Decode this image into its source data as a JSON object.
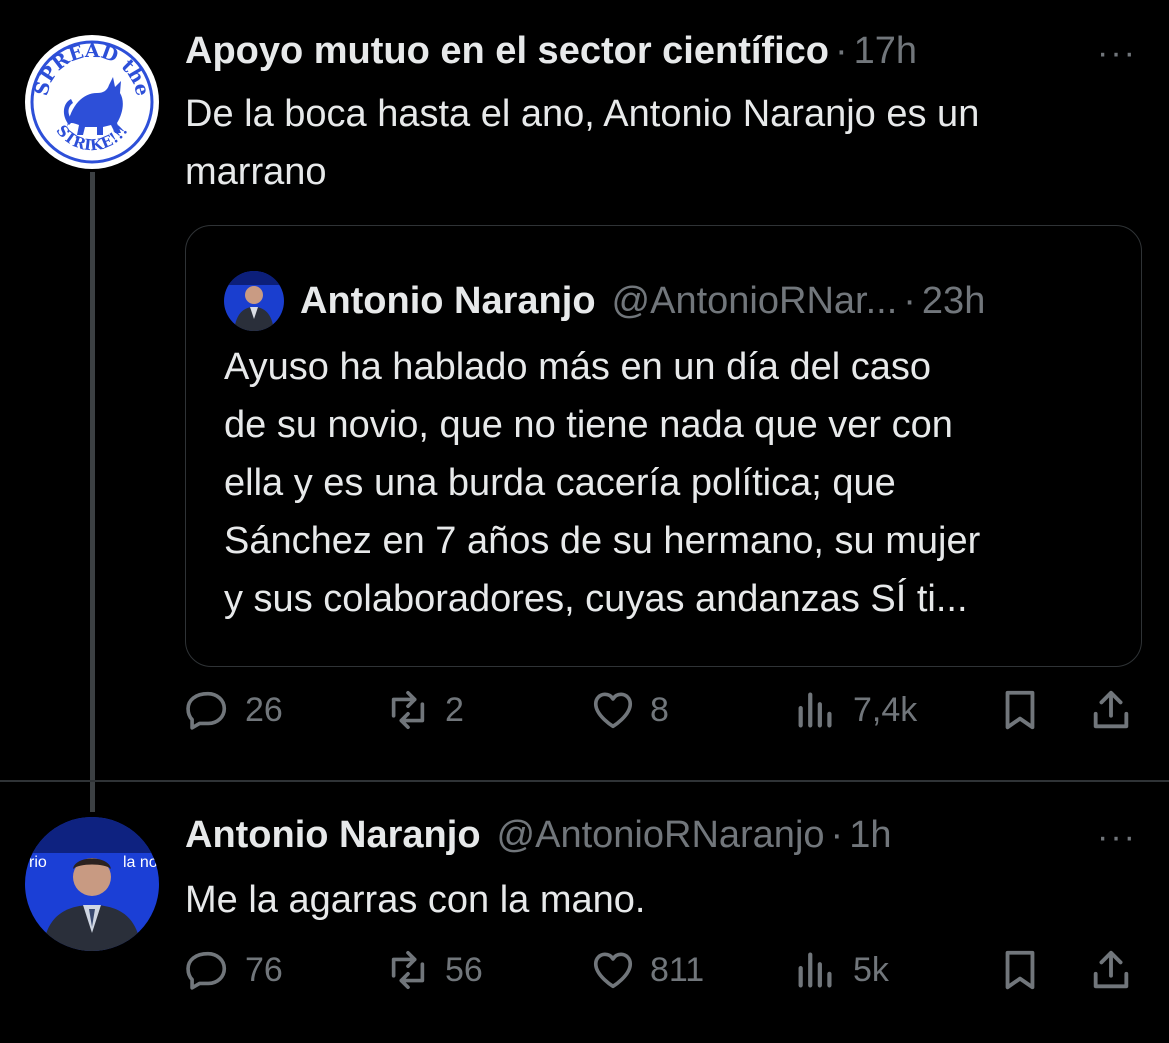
{
  "tweet1": {
    "author": "Apoyo mutuo en el sector científico",
    "separator": "·",
    "time": "17h",
    "more": "···",
    "text_line1": "De la boca hasta el ano, Antonio Naranjo es un",
    "text_line2": "marrano",
    "avatar_text_top": "SPREAD the",
    "avatar_text_bottom": "STRIKE!!!",
    "quote": {
      "author": "Antonio Naranjo",
      "handle": "@AntonioRNar...",
      "separator": "·",
      "time": "23h",
      "lines": [
        "Ayuso ha hablado más en un día del caso",
        "de su novio, que no tiene nada que ver con",
        "ella y es una burda cacería política; que",
        "Sánchez en 7 años de su hermano, su mujer",
        "y sus colaboradores, cuyas andanzas SÍ ti..."
      ]
    },
    "actions": {
      "replies": "26",
      "reposts": "2",
      "likes": "8",
      "views": "7,4k"
    }
  },
  "tweet2": {
    "author": "Antonio Naranjo",
    "handle": "@AntonioRNaranjo",
    "separator": "·",
    "time": "1h",
    "more": "···",
    "text": "Me la agarras con la mano.",
    "actions": {
      "replies": "76",
      "reposts": "56",
      "likes": "811",
      "views": "5k"
    }
  },
  "colors": {
    "background": "#000000",
    "text": "#e7e9ea",
    "muted": "#71767b",
    "border": "#2f3336",
    "avatar_blue": "#2d4fd8"
  },
  "icons": [
    "reply-icon",
    "repost-icon",
    "like-icon",
    "views-icon",
    "bookmark-icon",
    "share-icon",
    "more-icon"
  ]
}
